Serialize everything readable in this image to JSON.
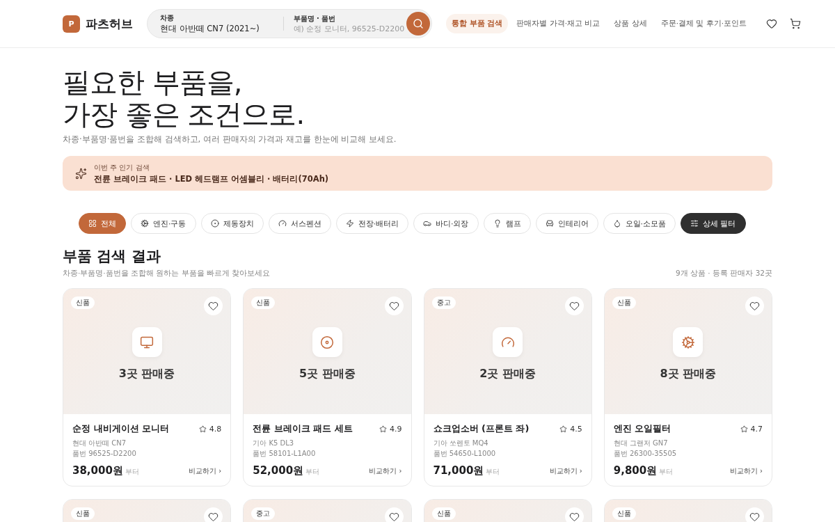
{
  "header": {
    "logo_mark": "P",
    "logo_text": "파츠허브",
    "search": {
      "vehicle_label": "차종",
      "vehicle_value": "현대 아반떼 CN7 (2021~)",
      "part_label": "부품명 · 품번",
      "part_placeholder": "예) 순정 모니터, 96525-D2200"
    },
    "nav": [
      {
        "label": "통합 부품 검색",
        "selected": true
      },
      {
        "label": "판매자별 가격·재고 비교",
        "selected": false
      },
      {
        "label": "상품 상세",
        "selected": false
      },
      {
        "label": "주문·결제 및 후기·포인트",
        "selected": false
      }
    ]
  },
  "hero": {
    "title_lines": [
      "필요한 부품을,",
      "가장 좋은 조건으로."
    ],
    "subtitle": "차종·부품명·품번을 조합해 검색하고, 여러 판매자의 가격과 재고를 한눈에 비교해 보세요."
  },
  "trending": {
    "label": "이번 주 인기 검색",
    "text": "전륜 브레이크 패드 · LED 헤드램프 어셈블리 · 배터리(70Ah)"
  },
  "chips": [
    {
      "label": "전체",
      "kind": "category",
      "selected": true
    },
    {
      "label": "엔진·구동",
      "kind": "category",
      "selected": false
    },
    {
      "label": "제동장치",
      "kind": "category",
      "selected": false
    },
    {
      "label": "서스펜션",
      "kind": "category",
      "selected": false
    },
    {
      "label": "전장·배터리",
      "kind": "category",
      "selected": false
    },
    {
      "label": "바디·외장",
      "kind": "category",
      "selected": false
    },
    {
      "label": "램프",
      "kind": "category",
      "selected": false
    },
    {
      "label": "인테리어",
      "kind": "category",
      "selected": false
    },
    {
      "label": "오일·소모품",
      "kind": "category",
      "selected": false
    },
    {
      "label": "상세 필터",
      "kind": "filter"
    }
  ],
  "results": {
    "title": "부품 검색 결과",
    "subtitle": "차종·부품명·품번을 조합해 원하는 부품을 빠르게 찾아보세요",
    "count": "9개 상품 · 등록 판매자 32곳",
    "cards": [
      {
        "kind": "full",
        "badge": "신품",
        "sellers": "3곳 판매중",
        "name": "순정 내비게이션 모니터",
        "rating": "4.8",
        "vehicle": "현대 아반떼 CN7",
        "part_no": "품번 96525-D2200",
        "price": "38,000원",
        "price_suffix": "부터",
        "compare": "비교하기 ›"
      },
      {
        "kind": "full",
        "badge": "신품",
        "sellers": "5곳 판매중",
        "name": "전륜 브레이크 패드 세트",
        "rating": "4.9",
        "vehicle": "기아 K5 DL3",
        "part_no": "품번 58101-L1A00",
        "price": "52,000원",
        "price_suffix": "부터",
        "compare": "비교하기 ›"
      },
      {
        "kind": "full",
        "badge": "중고",
        "sellers": "2곳 판매중",
        "name": "쇼크업소버 (프론트 좌)",
        "rating": "4.5",
        "vehicle": "기아 쏘렌토 MQ4",
        "part_no": "품번 54650-L1000",
        "price": "71,000원",
        "price_suffix": "부터",
        "compare": "비교하기 ›"
      },
      {
        "kind": "full",
        "badge": "신품",
        "sellers": "8곳 판매중",
        "name": "엔진 오일필터",
        "rating": "4.7",
        "vehicle": "현대 그랜저 GN7",
        "part_no": "품번 26300-35505",
        "price": "9,800원",
        "price_suffix": "부터",
        "compare": "비교하기 ›"
      },
      {
        "kind": "partial",
        "badge": "신품"
      },
      {
        "kind": "partial",
        "badge": "중고"
      },
      {
        "kind": "partial",
        "badge": "신품"
      },
      {
        "kind": "partial",
        "badge": "신품"
      }
    ]
  }
}
